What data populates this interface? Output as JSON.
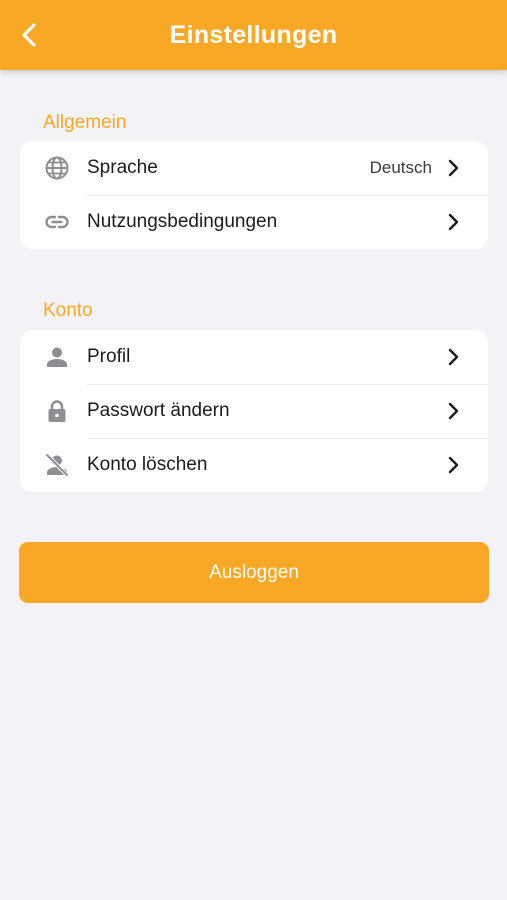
{
  "header": {
    "title": "Einstellungen",
    "back_icon": "chevron-left-icon"
  },
  "sections": {
    "general": {
      "title": "Allgemein",
      "items": [
        {
          "label": "Sprache",
          "value": "Deutsch",
          "icon": "globe-icon"
        },
        {
          "label": "Nutzungsbedingungen",
          "icon": "link-icon"
        }
      ]
    },
    "account": {
      "title": "Konto",
      "items": [
        {
          "label": "Profil",
          "icon": "person-icon"
        },
        {
          "label": "Passwort ändern",
          "icon": "lock-icon"
        },
        {
          "label": "Konto löschen",
          "icon": "person-slash-icon"
        }
      ]
    }
  },
  "logout": {
    "label": "Ausloggen"
  },
  "colors": {
    "accent": "#f8a824",
    "background": "#f2f2f7",
    "icon_gray": "#8e8e93"
  }
}
